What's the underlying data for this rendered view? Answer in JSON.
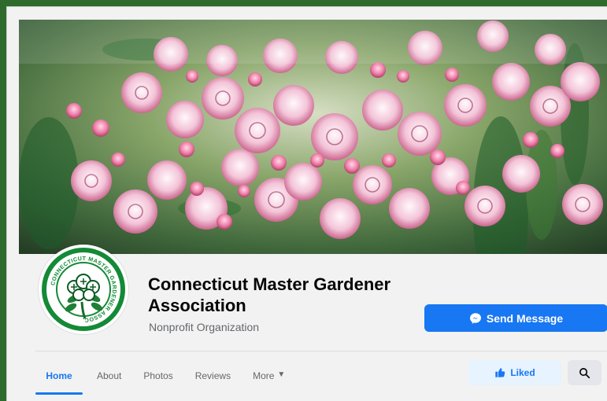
{
  "page": {
    "name": "Connecticut Master Gardener Association",
    "category": "Nonprofit Organization",
    "send_message_label": "Send Message",
    "liked_label": "Liked"
  },
  "tabs": [
    {
      "label": "Home",
      "active": true
    },
    {
      "label": "About",
      "active": false
    },
    {
      "label": "Photos",
      "active": false
    },
    {
      "label": "Reviews",
      "active": false
    },
    {
      "label": "More",
      "active": false
    }
  ],
  "logo": {
    "ring_text": "CONNECTICUT MASTER GARDENER ASSOC."
  },
  "icons": {
    "messenger": "messenger-icon",
    "liked": "thumbs-up-icon",
    "search": "search-icon",
    "more": "chevron-down-icon"
  },
  "colors": {
    "frame": "#2f6b2d",
    "panel": "#f2f2f2",
    "accent": "#1877f2",
    "liked_bg": "#e7f3ff",
    "search_bg": "#e4e6eb",
    "logo_green": "#138a36"
  }
}
